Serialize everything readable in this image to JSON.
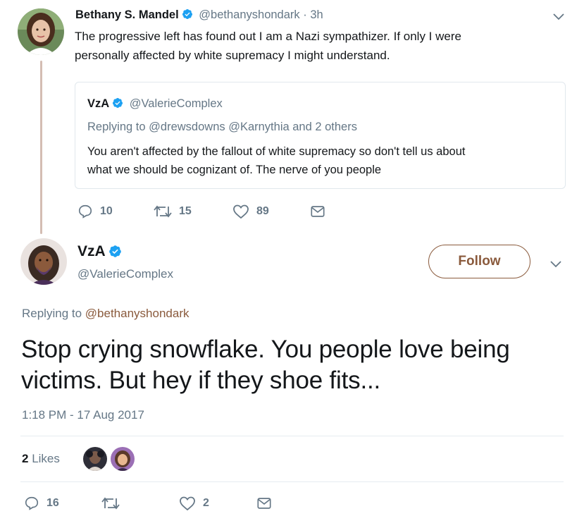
{
  "quoted_tweet": {
    "author_name": "Bethany S. Mandel",
    "author_handle": "@bethanyshondark",
    "time": "· 3h",
    "text_line1": "The progressive left has found out I am a Nazi sympathizer. If only I were",
    "text_line2": "personally affected by white supremacy I might understand.",
    "embedded": {
      "author_name": "VzA",
      "author_handle": "@ValerieComplex",
      "replying_prefix": "Replying to",
      "replying_targets": "@drewsdowns @Karnythia and 2 others",
      "text_line1": "You aren't affected by the fallout of white supremacy so don't tell us about",
      "text_line2": "what we should be cognizant of. The nerve of you people"
    },
    "actions": {
      "replies": "10",
      "retweets": "15",
      "likes": "89"
    }
  },
  "main_tweet": {
    "author_name": "VzA",
    "author_handle": "@ValerieComplex",
    "follow_label": "Follow",
    "replying_prefix": "Replying to",
    "replying_target": "@bethanyshondark",
    "text_line1": "Stop crying snowflake. You people love being",
    "text_line2": "victims. But hey if they shoe fits...",
    "timestamp": "1:18 PM - 17 Aug 2017",
    "likes_count": "2",
    "likes_label": "Likes",
    "actions": {
      "replies": "16",
      "retweets": "",
      "likes": "2"
    }
  },
  "colors": {
    "accent": "#8a5a3c",
    "verified": "#1da1f2",
    "muted": "#657786",
    "divider": "#e6ecf0"
  },
  "icons": [
    "reply-icon",
    "retweet-icon",
    "like-icon",
    "message-icon",
    "verified-icon",
    "chevron-down-icon"
  ]
}
